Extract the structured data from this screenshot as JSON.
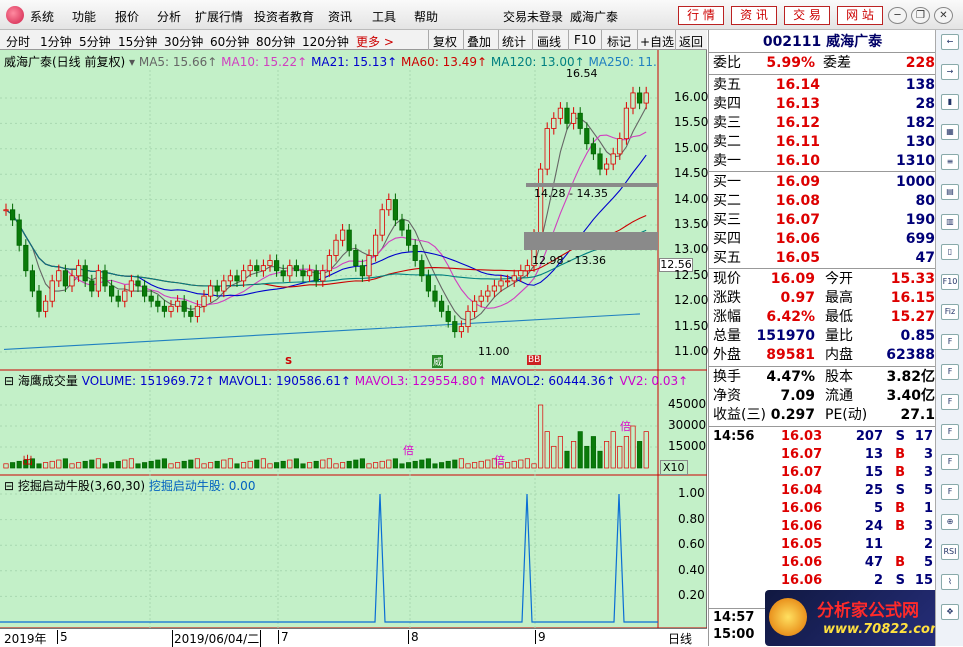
{
  "menubar": {
    "items": [
      "系统",
      "功能",
      "报价",
      "分析",
      "扩展行情",
      "投资者教育",
      "资讯",
      "工具",
      "帮助"
    ],
    "login": "交易未登录",
    "stock": "威海广泰",
    "buttons": [
      "行 情",
      "资 讯",
      "交 易",
      "网 站"
    ]
  },
  "toolbar": {
    "periods": [
      "分时",
      "1分钟",
      "5分钟",
      "15分钟",
      "30分钟",
      "60分钟",
      "80分钟",
      "120分钟"
    ],
    "more": "更多 >",
    "tools": [
      "复权",
      "叠加",
      "统计",
      "画线",
      "F10",
      "标记",
      "+自选",
      "返回"
    ]
  },
  "main_chart": {
    "title": "威海广泰(日线 前复权)",
    "indicators": [
      {
        "label": "MA5: 15.66",
        "color": "#666666"
      },
      {
        "label": "MA10: 15.22",
        "color": "#d040c0"
      },
      {
        "label": "MA21: 15.13",
        "color": "#0000cc"
      },
      {
        "label": "MA60: 13.49",
        "color": "#cc0000"
      },
      {
        "label": "MA120: 13.00",
        "color": "#008080"
      },
      {
        "label": "MA250: 11.",
        "color": "#2080c0"
      }
    ],
    "price_axis": [
      "16.00",
      "15.50",
      "15.00",
      "14.50",
      "14.00",
      "13.50",
      "13.00",
      "12.50",
      "12.00",
      "11.50",
      "11.00"
    ],
    "current_price_tag": "12.56",
    "annotations": {
      "high": "16.54",
      "low": "11.00",
      "zone1": "14.28 - 14.35",
      "zone2": "12.98 - 13.36"
    },
    "markers": {
      "s": "S",
      "w": "威",
      "b": "BB"
    }
  },
  "volume_chart": {
    "title": "海鹰成交量",
    "indicators": [
      {
        "label": "VOLUME: 151969.72",
        "color": "#0000cc"
      },
      {
        "label": "MAVOL1: 190586.61",
        "color": "#0000cc"
      },
      {
        "label": "MAVOL3: 129554.80",
        "color": "#cc00cc"
      },
      {
        "label": "MAVOL2: 60444.36",
        "color": "#0000cc"
      },
      {
        "label": "VV2: 0.03",
        "color": "#cc00cc"
      }
    ],
    "axis": [
      "45000",
      "30000",
      "15000"
    ],
    "unit": "X10",
    "labels": {
      "chu": "出",
      "bei": "倍"
    }
  },
  "sub_chart": {
    "title": "挖掘启动牛股(3,60,30)",
    "indicator": "挖掘启动牛股: 0.00",
    "axis": [
      "1.00",
      "0.80",
      "0.60",
      "0.40",
      "0.20"
    ]
  },
  "date_axis": {
    "labels": [
      "2019年",
      "5",
      "2019/06/04/二",
      "7",
      "8",
      "9"
    ],
    "period": "日线"
  },
  "quote": {
    "code_name": "002111 威海广泰",
    "weibi_label": "委比",
    "weibi": "5.99%",
    "weicha_label": "委差",
    "weicha": "228",
    "asks": [
      {
        "label": "卖五",
        "price": "16.14",
        "vol": "138"
      },
      {
        "label": "卖四",
        "price": "16.13",
        "vol": "28"
      },
      {
        "label": "卖三",
        "price": "16.12",
        "vol": "182"
      },
      {
        "label": "卖二",
        "price": "16.11",
        "vol": "130"
      },
      {
        "label": "卖一",
        "price": "16.10",
        "vol": "1310"
      }
    ],
    "bids": [
      {
        "label": "买一",
        "price": "16.09",
        "vol": "1000"
      },
      {
        "label": "买二",
        "price": "16.08",
        "vol": "80"
      },
      {
        "label": "买三",
        "price": "16.07",
        "vol": "190"
      },
      {
        "label": "买四",
        "price": "16.06",
        "vol": "699"
      },
      {
        "label": "买五",
        "price": "16.05",
        "vol": "47"
      }
    ],
    "stats": [
      {
        "l1": "现价",
        "v1": "16.09",
        "c1": "red",
        "l2": "今开",
        "v2": "15.33",
        "c2": "red"
      },
      {
        "l1": "涨跌",
        "v1": "0.97",
        "c1": "red",
        "l2": "最高",
        "v2": "16.15",
        "c2": "red"
      },
      {
        "l1": "涨幅",
        "v1": "6.42%",
        "c1": "red",
        "l2": "最低",
        "v2": "15.27",
        "c2": "red"
      },
      {
        "l1": "总量",
        "v1": "151970",
        "c1": "blue",
        "l2": "量比",
        "v2": "0.85",
        "c2": "blue"
      },
      {
        "l1": "外盘",
        "v1": "89581",
        "c1": "red",
        "l2": "内盘",
        "v2": "62388",
        "c2": "blue"
      }
    ],
    "finance": [
      {
        "l1": "换手",
        "v1": "4.47%",
        "l2": "股本",
        "v2": "3.82亿"
      },
      {
        "l1": "净资",
        "v1": "7.09",
        "l2": "流通",
        "v2": "3.40亿"
      },
      {
        "l1": "收益(三)",
        "v1": "0.297",
        "l2": "PE(动)",
        "v2": "27.1"
      }
    ],
    "ticks": [
      {
        "t": "14:56",
        "p": "16.03",
        "v": "207",
        "bs": "S",
        "n": "17"
      },
      {
        "t": "",
        "p": "16.07",
        "v": "13",
        "bs": "B",
        "n": "3"
      },
      {
        "t": "",
        "p": "16.07",
        "v": "15",
        "bs": "B",
        "n": "3"
      },
      {
        "t": "",
        "p": "16.04",
        "v": "25",
        "bs": "S",
        "n": "5"
      },
      {
        "t": "",
        "p": "16.06",
        "v": "5",
        "bs": "B",
        "n": "1"
      },
      {
        "t": "",
        "p": "16.06",
        "v": "24",
        "bs": "B",
        "n": "3"
      },
      {
        "t": "",
        "p": "16.05",
        "v": "11",
        "bs": "",
        "n": "2"
      },
      {
        "t": "",
        "p": "16.06",
        "v": "47",
        "bs": "B",
        "n": "5"
      },
      {
        "t": "",
        "p": "16.06",
        "v": "2",
        "bs": "S",
        "n": "15"
      }
    ],
    "time1": "14:57",
    "time2": "15:00"
  },
  "watermark": {
    "text": "分析家公式网",
    "url": "www.70822.com"
  },
  "sidebar_icons": [
    "arrow-left",
    "arrow-right",
    "candles",
    "grid",
    "list",
    "table",
    "chart",
    "kline",
    "f10",
    "fiz",
    "f",
    "f2",
    "f3",
    "f4",
    "f5",
    "f6",
    "zoom",
    "rsi",
    "line",
    "move"
  ]
}
